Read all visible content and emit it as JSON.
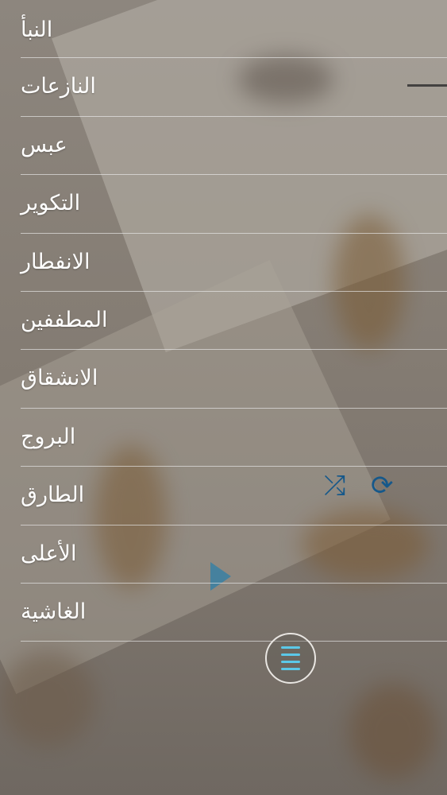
{
  "surah_list": {
    "items": [
      {
        "label": "النبأ"
      },
      {
        "label": "النازعات"
      },
      {
        "label": "عبس"
      },
      {
        "label": "التكوير"
      },
      {
        "label": "الانفطار"
      },
      {
        "label": "المطففين"
      },
      {
        "label": "الانشقاق"
      },
      {
        "label": "البروج"
      },
      {
        "label": "الطارق"
      },
      {
        "label": "الأعلى"
      },
      {
        "label": "الغاشية"
      }
    ]
  },
  "player": {
    "shuffle_icon": "⤮",
    "repeat_icon": "⟳"
  },
  "menu_button": {
    "icon": "menu-icon",
    "icon_color": "#5bc8e8"
  }
}
